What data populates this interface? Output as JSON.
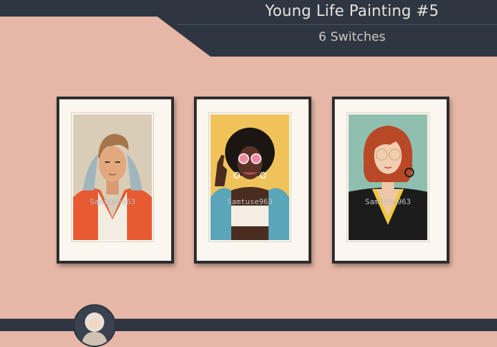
{
  "header": {
    "title": "Young Life Painting #5",
    "subtitle": "6 Switches"
  },
  "paintings": [
    {
      "watermark": "Samtuse963",
      "subject": "young man with red jacket"
    },
    {
      "watermark": "Samtuse963",
      "subject": "woman with curly hair and pink sunglasses"
    },
    {
      "watermark": "Samtuse963",
      "subject": "woman with red bob and round glasses"
    }
  ],
  "colors": {
    "background": "#e6b6a6",
    "header_band": "#2e3641",
    "title_text": "#e8e2dc",
    "frame": "#2b2b2d",
    "mat": "#fbf7ef"
  },
  "icons": {
    "creator_avatar": "avatar-icon"
  }
}
